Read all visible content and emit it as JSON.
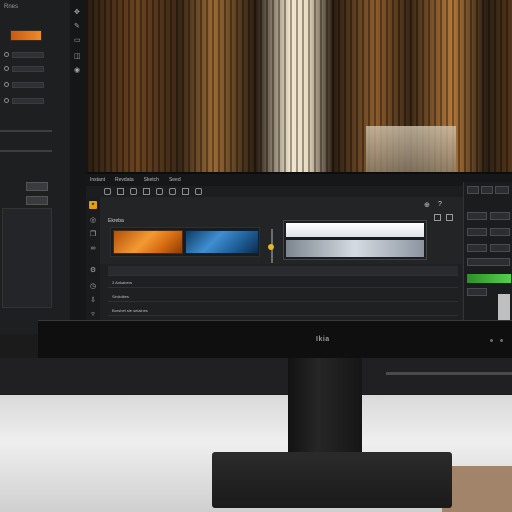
{
  "left_monitor": {
    "title": "Rnes",
    "accent_color": "#f08a2a"
  },
  "main_monitor": {
    "menu": [
      "Instant",
      "Revdata",
      "Sketch",
      "Seed"
    ],
    "panel_header": "Ekreba",
    "layers": [
      "",
      "3 Ankabers",
      "Sinilolites",
      "Borshet sle selaines"
    ],
    "accent_color": "#e0a012",
    "status_green": "#54d14d"
  },
  "bezel": {
    "logo": "Ikia"
  }
}
